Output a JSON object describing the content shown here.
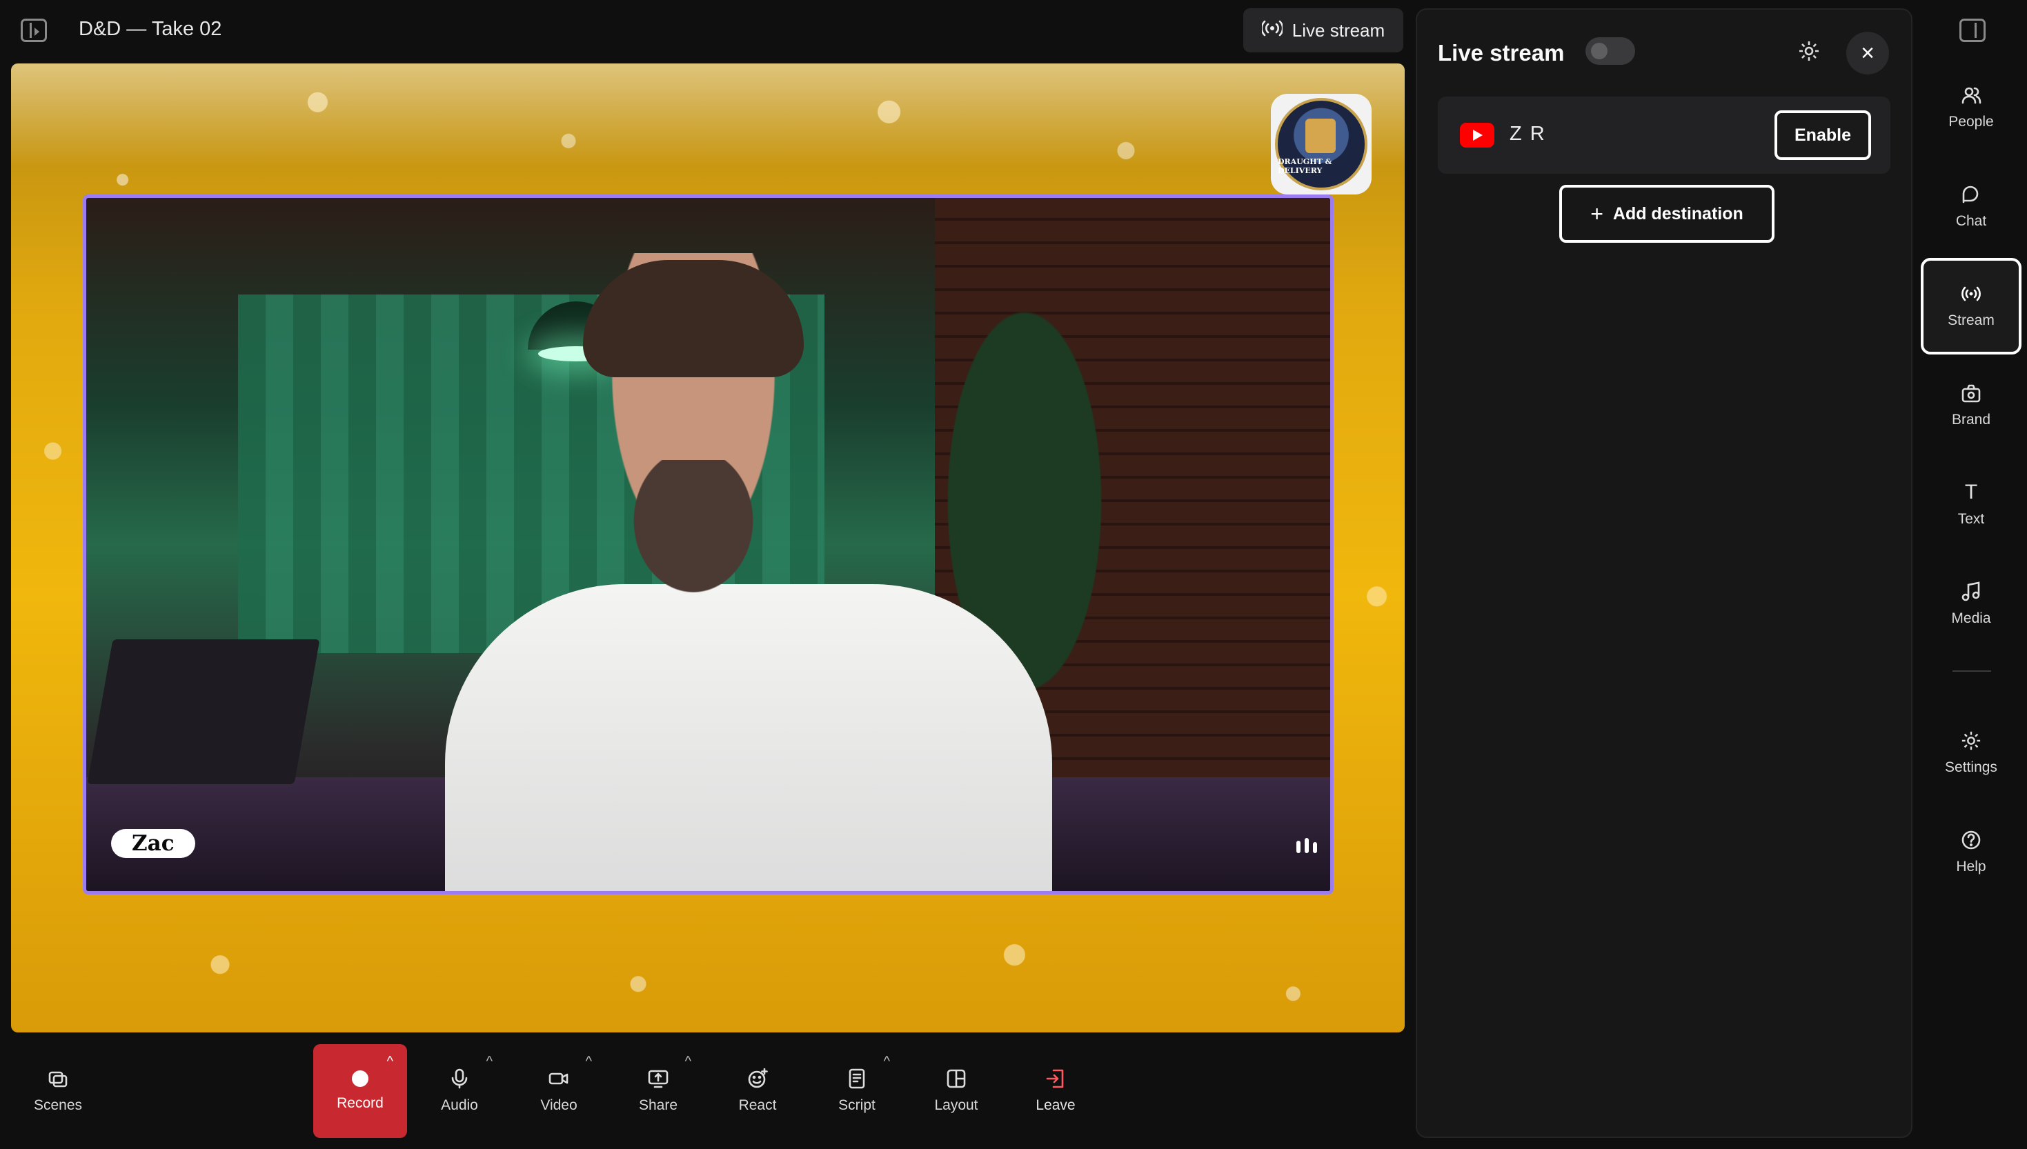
{
  "header": {
    "title": "D&D — Take 02",
    "live_stream_label": "Live stream"
  },
  "stage": {
    "participant_name": "Zac",
    "logo_text": "DRAUGHT & DELIVERY"
  },
  "toolbar": {
    "scenes": "Scenes",
    "record": "Record",
    "audio": "Audio",
    "video": "Video",
    "share": "Share",
    "react": "React",
    "script": "Script",
    "layout": "Layout",
    "leave": "Leave"
  },
  "panel": {
    "title": "Live stream",
    "destination": {
      "name": "Z R",
      "platform": "youtube-icon",
      "action": "Enable"
    },
    "add_destination": "Add destination"
  },
  "rail": {
    "items": [
      {
        "label": "People"
      },
      {
        "label": "Chat"
      },
      {
        "label": "Stream"
      },
      {
        "label": "Brand"
      },
      {
        "label": "Text"
      },
      {
        "label": "Media"
      },
      {
        "label": "Settings"
      },
      {
        "label": "Help"
      }
    ],
    "active": "Stream"
  },
  "colors": {
    "record": "#c8282f",
    "frame": "#9b7df0",
    "youtube": "#ff0000"
  }
}
